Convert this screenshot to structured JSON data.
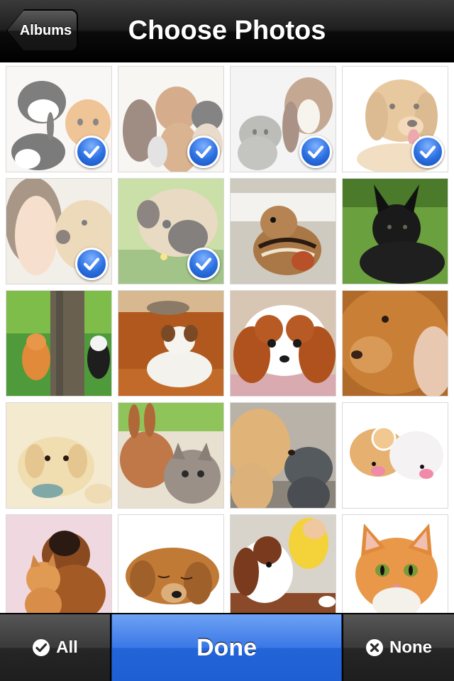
{
  "navbar": {
    "back_label": "Albums",
    "title": "Choose Photos"
  },
  "toolbar": {
    "all_label": "All",
    "done_label": "Done",
    "none_label": "None",
    "accent_color": "#2a6fe0"
  },
  "photos": [
    {
      "subject": "puppy-kitten-bunny",
      "selected": true
    },
    {
      "subject": "cat-and-dogs-group",
      "selected": true
    },
    {
      "subject": "basset-hound-and-tabby-cat",
      "selected": true
    },
    {
      "subject": "golden-retriever",
      "selected": true
    },
    {
      "subject": "woman-and-puppy",
      "selected": true
    },
    {
      "subject": "pug-in-grass",
      "selected": true
    },
    {
      "subject": "chipmunk",
      "selected": false
    },
    {
      "subject": "black-puppy-on-grass",
      "selected": false
    },
    {
      "subject": "kittens-climbing-tree",
      "selected": false
    },
    {
      "subject": "jack-russell-on-sofa",
      "selected": false
    },
    {
      "subject": "cavalier-spaniel-puppy",
      "selected": false
    },
    {
      "subject": "golden-retriever-closeup",
      "selected": false
    },
    {
      "subject": "lab-puppy-with-toy",
      "selected": false
    },
    {
      "subject": "bunny-and-kitten",
      "selected": false
    },
    {
      "subject": "dog-and-kitten-nose",
      "selected": false
    },
    {
      "subject": "toy-hamsters",
      "selected": false
    },
    {
      "subject": "puppy-hugging-kitten",
      "selected": false
    },
    {
      "subject": "sleeping-puppy",
      "selected": false
    },
    {
      "subject": "spaniel-with-child",
      "selected": false
    },
    {
      "subject": "orange-kitten",
      "selected": false
    }
  ]
}
